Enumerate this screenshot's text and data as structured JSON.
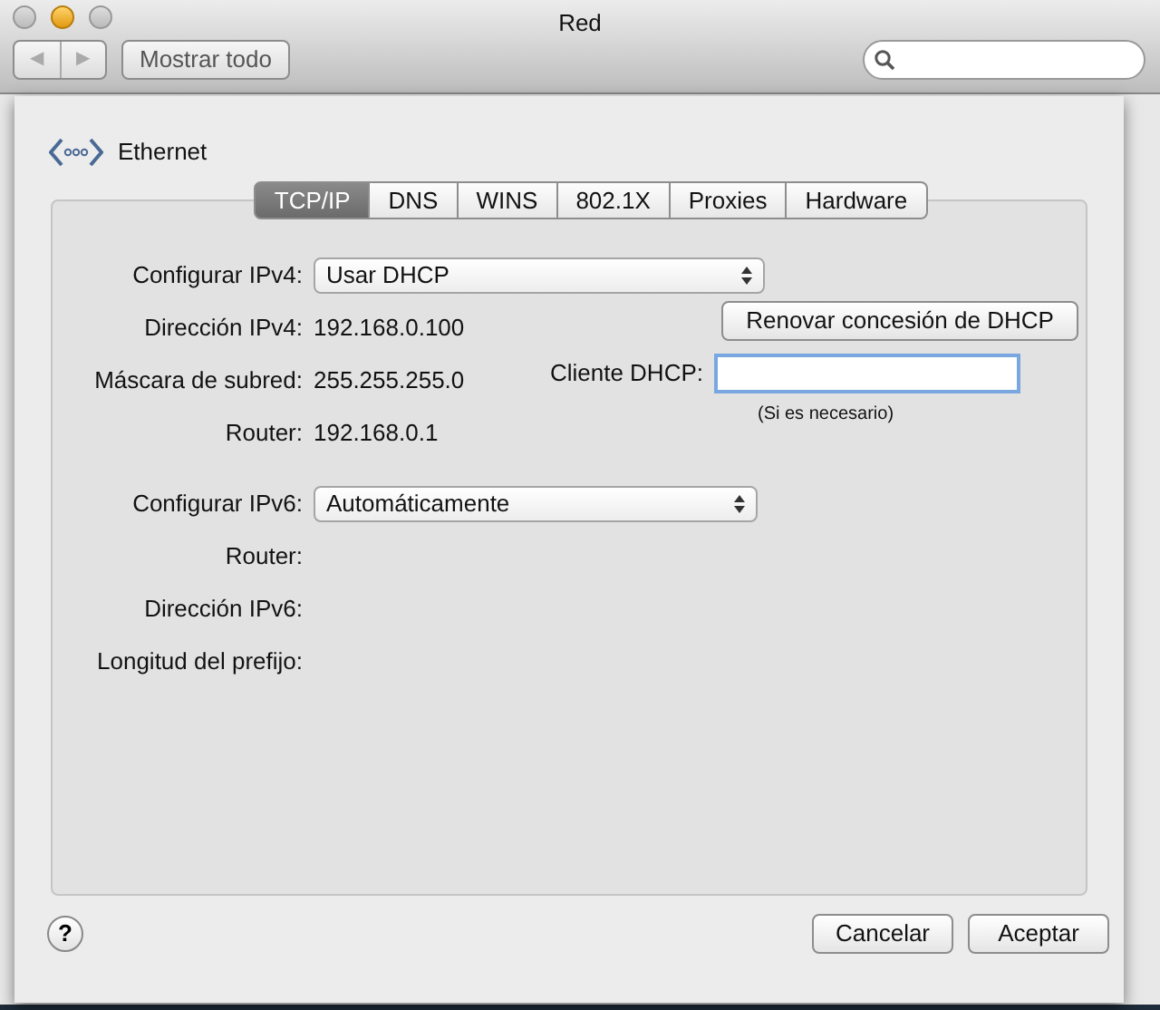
{
  "window": {
    "title": "Red"
  },
  "toolbar": {
    "back": "◀",
    "forward": "▶",
    "show_all": "Mostrar todo"
  },
  "service": {
    "name": "Ethernet"
  },
  "tabs": [
    {
      "label": "TCP/IP",
      "selected": true
    },
    {
      "label": "DNS",
      "selected": false
    },
    {
      "label": "WINS",
      "selected": false
    },
    {
      "label": "802.1X",
      "selected": false
    },
    {
      "label": "Proxies",
      "selected": false
    },
    {
      "label": "Hardware",
      "selected": false
    }
  ],
  "fields": [
    {
      "kind": "popup",
      "label": "Configurar IPv4:",
      "value": "Usar DHCP"
    },
    {
      "kind": "text",
      "label": "Dirección IPv4:",
      "value": "192.168.0.100"
    },
    {
      "kind": "text",
      "label": "Máscara de subred:",
      "value": "255.255.255.0"
    },
    {
      "kind": "text",
      "label": "Router:",
      "value": "192.168.0.1"
    },
    {
      "kind": "popup",
      "label": "Configurar IPv6:",
      "value": "Automáticamente"
    },
    {
      "kind": "text",
      "label": "Router:"
    },
    {
      "kind": "text",
      "label": "Dirección IPv6:"
    },
    {
      "kind": "text",
      "label": "Longitud del prefijo:"
    }
  ],
  "renew_button": "Renovar concesión de DHCP",
  "dhcp_client": {
    "label": "Cliente DHCP:",
    "hint": "(Si es necesario)"
  },
  "help": "?",
  "buttons": [
    {
      "label": "Cancelar",
      "default": false
    },
    {
      "label": "Aceptar",
      "default": false
    }
  ]
}
